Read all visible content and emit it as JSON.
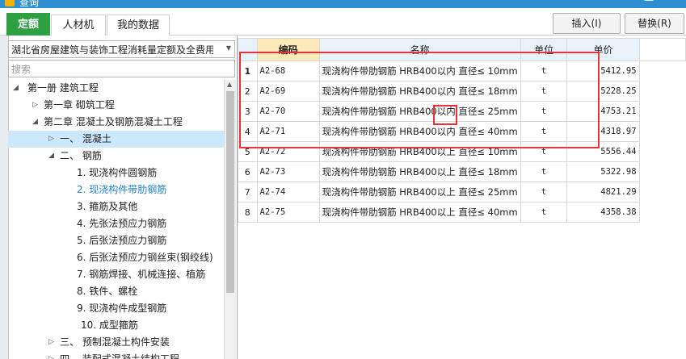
{
  "window": {
    "title": "查询",
    "close_glyph": "—"
  },
  "tabs": [
    {
      "label": "定额"
    },
    {
      "label": "人材机"
    },
    {
      "label": "我的数据"
    }
  ],
  "toolbar": {
    "insert_label": "插入(I)",
    "replace_label": "替换(R)"
  },
  "left": {
    "library": "湖北省房屋建筑与装饰工程消耗量定额及全费用基",
    "search_placeholder": "搜索",
    "tree": [
      {
        "label": "第一册  建筑工程",
        "toggle": "◢"
      },
      {
        "label": "第一章  砌筑工程",
        "toggle": "▷"
      },
      {
        "label": "第二章  混凝土及钢筋混凝土工程",
        "toggle": "◢"
      },
      {
        "label": "一、  混凝土",
        "toggle": "▷"
      },
      {
        "label": "二、  钢筋",
        "toggle": "◢"
      },
      {
        "label": "1.  现浇构件圆钢筋",
        "toggle": ""
      },
      {
        "label": "2.  现浇构件带肋钢筋",
        "toggle": ""
      },
      {
        "label": "3.  箍筋及其他",
        "toggle": ""
      },
      {
        "label": "4.  先张法预应力钢筋",
        "toggle": ""
      },
      {
        "label": "5.  后张法预应力钢筋",
        "toggle": ""
      },
      {
        "label": "6.  后张法预应力钢丝束(钢绞线)",
        "toggle": ""
      },
      {
        "label": "7.  钢筋焊接、机械连接、植筋",
        "toggle": ""
      },
      {
        "label": "8.  铁件、螺栓",
        "toggle": ""
      },
      {
        "label": "9.  现浇构件成型钢筋",
        "toggle": ""
      },
      {
        "label": "10.  成型箍筋",
        "toggle": ""
      },
      {
        "label": "三、  预制混凝土构件安装",
        "toggle": "▷"
      },
      {
        "label": "四、  装配式混凝土结构工程",
        "toggle": "▷"
      }
    ]
  },
  "grid": {
    "columns": [
      "编码",
      "名称",
      "单位",
      "单价"
    ],
    "rows": [
      {
        "no": "1",
        "code": "A2-68",
        "name": "现浇构件带肋钢筋 HRB400以内 直径≤ 10mm",
        "unit": "t",
        "price": "5412.95"
      },
      {
        "no": "2",
        "code": "A2-69",
        "name": "现浇构件带肋钢筋 HRB400以内 直径≤ 18mm",
        "unit": "t",
        "price": "5228.25"
      },
      {
        "no": "3",
        "code": "A2-70",
        "name": "现浇构件带肋钢筋 HRB400以内 直径≤ 25mm",
        "unit": "t",
        "price": "4753.21"
      },
      {
        "no": "4",
        "code": "A2-71",
        "name": "现浇构件带肋钢筋 HRB400以内 直径≤ 40mm",
        "unit": "t",
        "price": "4318.97"
      },
      {
        "no": "5",
        "code": "A2-72",
        "name": "现浇构件带肋钢筋 HRB400以上 直径≤ 10mm",
        "unit": "t",
        "price": "5556.44"
      },
      {
        "no": "6",
        "code": "A2-73",
        "name": "现浇构件带肋钢筋 HRB400以上 直径≤ 18mm",
        "unit": "t",
        "price": "5322.98"
      },
      {
        "no": "7",
        "code": "A2-74",
        "name": "现浇构件带肋钢筋 HRB400以上 直径≤ 25mm",
        "unit": "t",
        "price": "4821.29"
      },
      {
        "no": "8",
        "code": "A2-75",
        "name": "现浇构件带肋钢筋 HRB400以上 直径≤ 40mm",
        "unit": "t",
        "price": "4358.38"
      }
    ]
  },
  "colors": {
    "active_tab": "#2ea043",
    "highlight": "#e8333a",
    "selection": "#cce8ff",
    "code_header": "#fbe9b7"
  }
}
